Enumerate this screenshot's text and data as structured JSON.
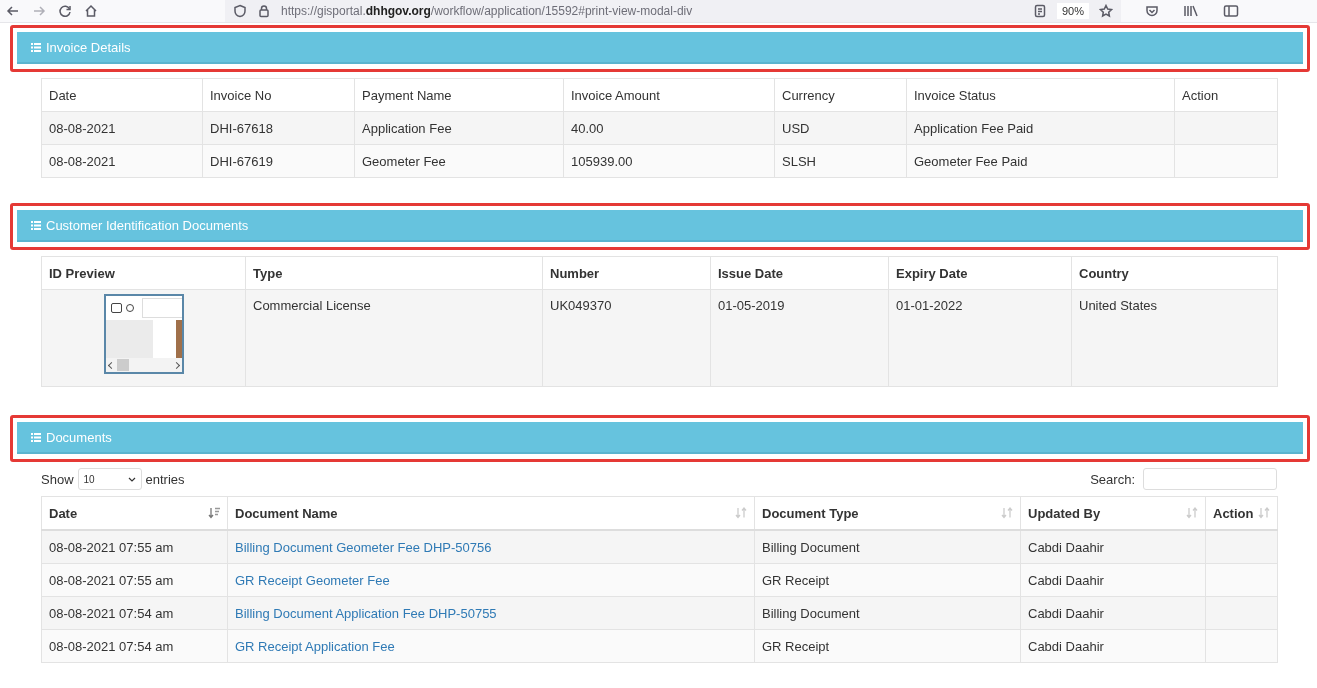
{
  "browser": {
    "url": "https://gisportal.**dhhgov.org**/workflow/application/15592#print-view-modal-div",
    "zoom": "90%"
  },
  "sections": [
    {
      "kind": "table",
      "title": "Invoice Details",
      "table": {
        "columns": [
          {
            "label": "Date"
          },
          {
            "label": "Invoice No"
          },
          {
            "label": "Payment Name"
          },
          {
            "label": "Invoice Amount"
          },
          {
            "label": "Currency"
          },
          {
            "label": "Invoice Status"
          },
          {
            "label": "Action"
          }
        ],
        "rows": [
          [
            "08-08-2021",
            "DHI-67618",
            "Application Fee",
            "40.00",
            "USD",
            "Application Fee Paid",
            ""
          ],
          [
            "08-08-2021",
            "DHI-67619",
            "Geometer Fee",
            "105939.00",
            "SLSH",
            "Geometer Fee Paid",
            ""
          ]
        ]
      }
    },
    {
      "kind": "id",
      "title": "Customer Identification Documents",
      "table": {
        "columns": [
          {
            "label": "ID Preview"
          },
          {
            "label": "Type"
          },
          {
            "label": "Number"
          },
          {
            "label": "Issue Date"
          },
          {
            "label": "Expiry Date"
          },
          {
            "label": "Country"
          }
        ],
        "rows": [
          [
            "",
            "Commercial License",
            "UK049370",
            "01-05-2019",
            "01-01-2022",
            "United States"
          ]
        ]
      }
    },
    {
      "kind": "datatable",
      "title": "Documents",
      "controls": {
        "show": "Show",
        "page_size": "10",
        "entries": "entries",
        "search": "Search:"
      },
      "table": {
        "columns": [
          {
            "label": "Date",
            "sorted": true
          },
          {
            "label": "Document Name",
            "sorted": false
          },
          {
            "label": "Document Type",
            "sorted": false
          },
          {
            "label": "Updated By",
            "sorted": false
          },
          {
            "label": "Action",
            "sorted": false
          }
        ],
        "rows": [
          [
            "08-08-2021 07:55 am",
            "Billing Document Geometer Fee DHP-50756",
            "Billing Document",
            "Cabdi Daahir",
            ""
          ],
          [
            "08-08-2021 07:55 am",
            "GR Receipt Geometer Fee",
            "GR Receipt",
            "Cabdi Daahir",
            ""
          ],
          [
            "08-08-2021 07:54 am",
            "Billing Document Application Fee DHP-50755",
            "Billing Document",
            "Cabdi Daahir",
            ""
          ],
          [
            "08-08-2021 07:54 am",
            "GR Receipt Application Fee",
            "GR Receipt",
            "Cabdi Daahir",
            ""
          ]
        ]
      }
    }
  ]
}
